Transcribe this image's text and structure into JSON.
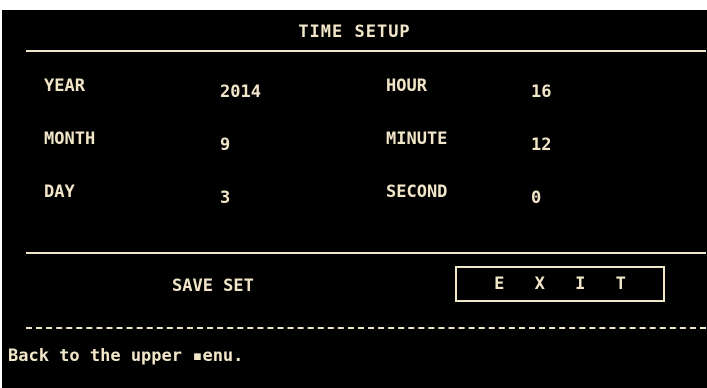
{
  "title": "TIME SETUP",
  "fields": {
    "year": {
      "label": "YEAR",
      "value": "2014"
    },
    "month": {
      "label": "MONTH",
      "value": "9"
    },
    "day": {
      "label": "DAY",
      "value": "3"
    },
    "hour": {
      "label": "HOUR",
      "value": "16"
    },
    "minute": {
      "label": "MINUTE",
      "value": "12"
    },
    "second": {
      "label": "SECOND",
      "value": "0"
    }
  },
  "buttons": {
    "save_label": "SAVE SET",
    "exit_label": "E X I T"
  },
  "help_text": "Back to the upper ▪enu."
}
